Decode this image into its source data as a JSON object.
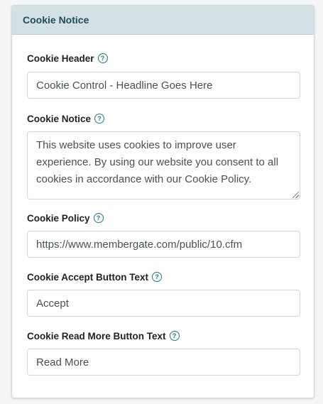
{
  "panel": {
    "title": "Cookie Notice"
  },
  "fields": {
    "header": {
      "label": "Cookie Header",
      "value": "Cookie Control - Headline Goes Here"
    },
    "notice": {
      "label": "Cookie Notice",
      "value": "This website uses cookies to improve user experience. By using our website you consent to all cookies in accordance with our Cookie Policy."
    },
    "policy": {
      "label": "Cookie Policy",
      "value": "https://www.membergate.com/public/10.cfm"
    },
    "accept": {
      "label": "Cookie Accept Button Text",
      "value": "Accept"
    },
    "read_more": {
      "label": "Cookie Read More Button Text",
      "value": "Read More"
    }
  },
  "help_icon": {
    "glyph": "?",
    "name": "question-circle-icon",
    "color": "#1a7a8a"
  },
  "colors": {
    "header_bg": "#d3e0e4",
    "title_text": "#1e4d5c"
  }
}
